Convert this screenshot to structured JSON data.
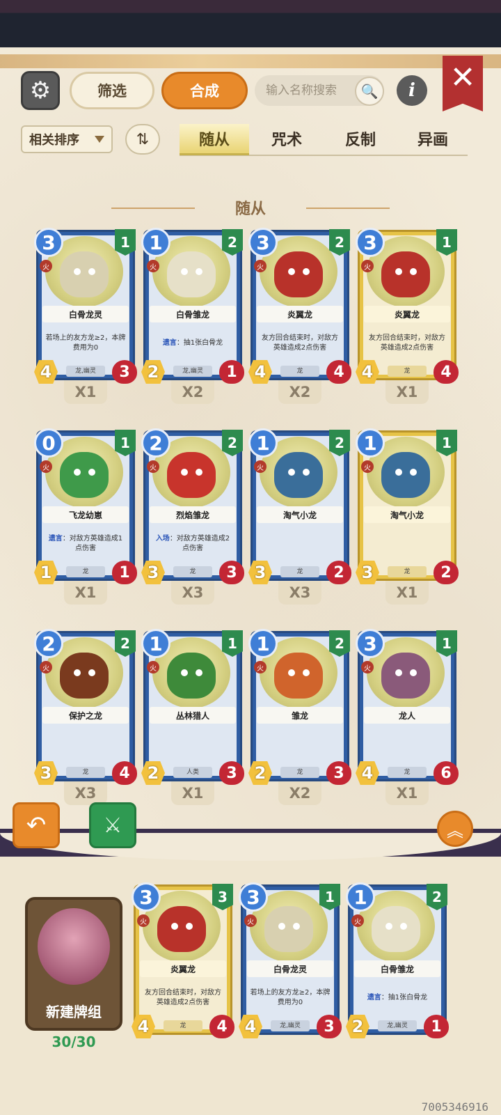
{
  "header": {
    "filter_label": "筛选",
    "compose_label": "合成",
    "search_placeholder": "输入名称搜索",
    "close_symbol": "✕",
    "info_symbol": "i"
  },
  "sort": {
    "label": "相关排序"
  },
  "tabs": [
    {
      "label": "随从",
      "active": true
    },
    {
      "label": "咒术",
      "active": false
    },
    {
      "label": "反制",
      "active": false
    },
    {
      "label": "异画",
      "active": false
    }
  ],
  "section_title": "随从",
  "cards": [
    {
      "name": "白骨龙灵",
      "cost": "3",
      "tier": "1",
      "element": "火",
      "attack": "4",
      "health": "3",
      "race": "龙,幽灵",
      "count": "X1",
      "desc": "若场上的友方龙≥2，本牌费用为0",
      "keyword": "",
      "gold": false,
      "color": "#d8d0b0"
    },
    {
      "name": "白骨雏龙",
      "cost": "1",
      "tier": "2",
      "element": "火",
      "attack": "2",
      "health": "1",
      "race": "龙,幽灵",
      "count": "X2",
      "desc": "：抽1张白骨龙",
      "keyword": "遗言",
      "gold": false,
      "color": "#e6e0c8"
    },
    {
      "name": "炎翼龙",
      "cost": "3",
      "tier": "2",
      "element": "火",
      "attack": "4",
      "health": "4",
      "race": "龙",
      "count": "X2",
      "desc": "友方回合结束时，对敌方英雄造成2点伤害",
      "keyword": "",
      "gold": false,
      "color": "#b8322a"
    },
    {
      "name": "炎翼龙",
      "cost": "3",
      "tier": "1",
      "element": "火",
      "attack": "4",
      "health": "4",
      "race": "龙",
      "count": "X1",
      "desc": "友方回合结束时，对敌方英雄造成2点伤害",
      "keyword": "",
      "gold": true,
      "color": "#b8322a"
    },
    {
      "name": "飞龙幼崽",
      "cost": "0",
      "tier": "1",
      "element": "火",
      "attack": "1",
      "health": "1",
      "race": "龙",
      "count": "X1",
      "desc": "：对敌方英雄造成1点伤害",
      "keyword": "遗言",
      "gold": false,
      "color": "#3f9a4a"
    },
    {
      "name": "烈焰雏龙",
      "cost": "2",
      "tier": "2",
      "element": "火",
      "attack": "3",
      "health": "3",
      "race": "龙",
      "count": "X3",
      "desc": "：对敌方英雄造成2点伤害",
      "keyword": "入场",
      "gold": false,
      "color": "#c8342c"
    },
    {
      "name": "淘气小龙",
      "cost": "1",
      "tier": "2",
      "element": "火",
      "attack": "3",
      "health": "2",
      "race": "龙",
      "count": "X3",
      "desc": "",
      "keyword": "",
      "gold": false,
      "color": "#3a6e9a"
    },
    {
      "name": "淘气小龙",
      "cost": "1",
      "tier": "1",
      "element": "火",
      "attack": "3",
      "health": "2",
      "race": "龙",
      "count": "X1",
      "desc": "",
      "keyword": "",
      "gold": true,
      "color": "#3a6e9a"
    },
    {
      "name": "保护之龙",
      "cost": "2",
      "tier": "2",
      "element": "火",
      "attack": "3",
      "health": "4",
      "race": "龙",
      "count": "X3",
      "desc": "",
      "keyword": "",
      "gold": false,
      "color": "#7a3a1e"
    },
    {
      "name": "丛林猎人",
      "cost": "1",
      "tier": "1",
      "element": "火",
      "attack": "2",
      "health": "3",
      "race": "人类",
      "count": "X1",
      "desc": "",
      "keyword": "",
      "gold": false,
      "color": "#3e8a3a"
    },
    {
      "name": "雏龙",
      "cost": "1",
      "tier": "2",
      "element": "火",
      "attack": "2",
      "health": "3",
      "race": "龙",
      "count": "X2",
      "desc": "",
      "keyword": "",
      "gold": false,
      "color": "#d0642c"
    },
    {
      "name": "龙人",
      "cost": "3",
      "tier": "1",
      "element": "火",
      "attack": "4",
      "health": "6",
      "race": "龙",
      "count": "X1",
      "desc": "",
      "keyword": "",
      "gold": false,
      "color": "#8a5a7a"
    }
  ],
  "deck": {
    "label": "新建牌组",
    "count": "30/30",
    "cards": [
      {
        "name": "炎翼龙",
        "cost": "3",
        "tier": "3",
        "element": "火",
        "attack": "4",
        "health": "4",
        "race": "龙",
        "desc": "友方回合结束时，对敌方英雄造成2点伤害",
        "keyword": "",
        "gold": true,
        "color": "#b8322a"
      },
      {
        "name": "白骨龙灵",
        "cost": "3",
        "tier": "1",
        "element": "火",
        "attack": "4",
        "health": "3",
        "race": "龙,幽灵",
        "desc": "若场上的友方龙≥2，本牌费用为0",
        "keyword": "",
        "gold": false,
        "color": "#d8d0b0"
      },
      {
        "name": "白骨雏龙",
        "cost": "1",
        "tier": "2",
        "element": "火",
        "attack": "2",
        "health": "1",
        "race": "龙,幽灵",
        "desc": "：抽1张白骨龙",
        "keyword": "遗言",
        "gold": false,
        "color": "#e6e0c8"
      }
    ]
  },
  "watermark": "7005346916"
}
